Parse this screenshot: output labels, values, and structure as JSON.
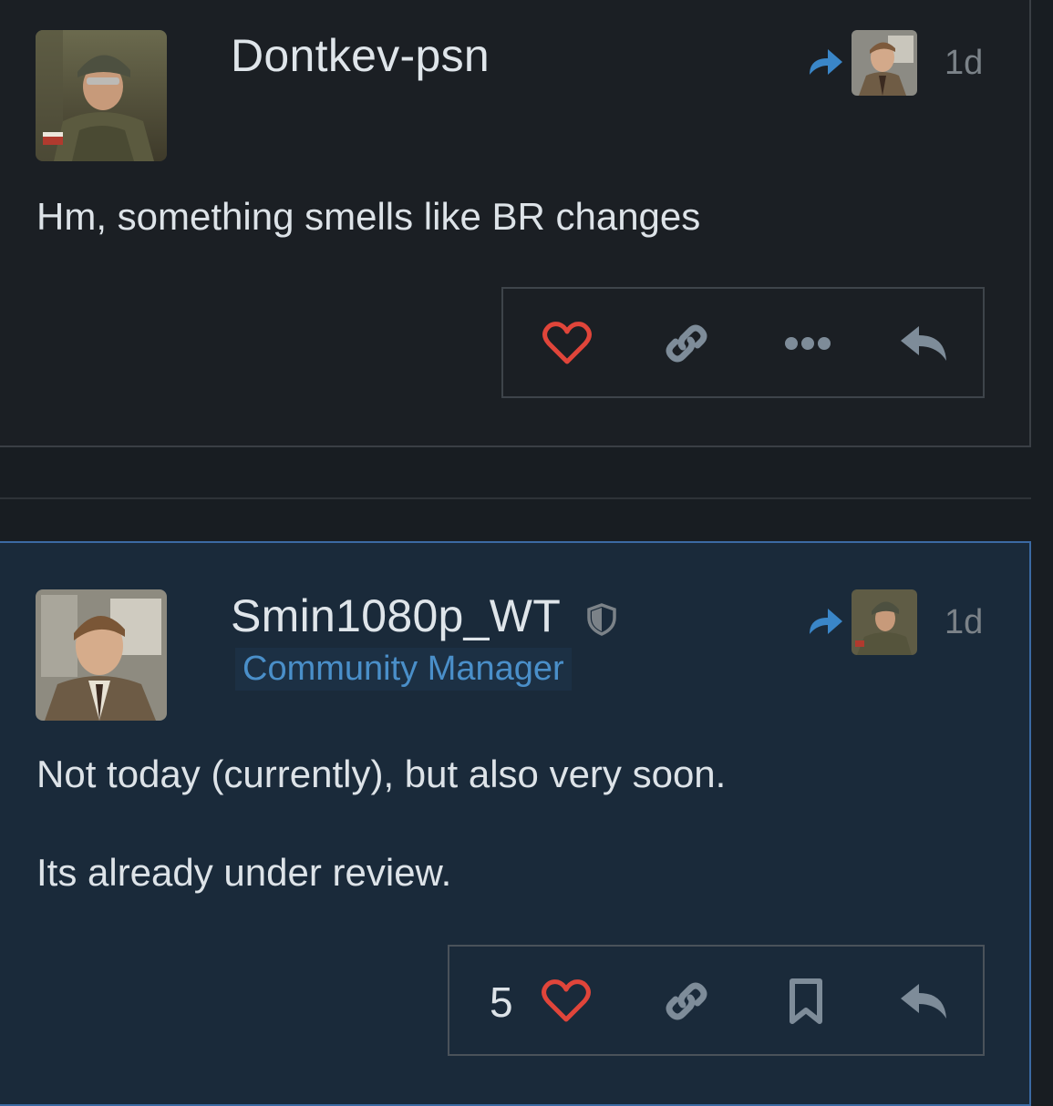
{
  "posts": [
    {
      "username": "Dontkev-psn",
      "time": "1d",
      "body": [
        "Hm, something smells like BR changes"
      ],
      "avatar_icon": "soldier-avatar",
      "reply_to_avatar_icon": "man-in-suit-avatar"
    },
    {
      "username": "Smin1080p_WT",
      "flair": "Community Manager",
      "time": "1d",
      "body": [
        "Not today (currently), but also very soon.",
        "Its already under review."
      ],
      "likes": "5",
      "avatar_icon": "man-in-suit-avatar",
      "reply_to_avatar_icon": "soldier-avatar"
    }
  ],
  "colors": {
    "background": "#181d22",
    "post_bg": "#1b1f24",
    "highlight_post_bg": "#1a2a3a",
    "highlight_border": "#3b6aa3",
    "like": "#e0453a",
    "accent": "#3a86c8",
    "muted_icon": "#7e8c99"
  }
}
